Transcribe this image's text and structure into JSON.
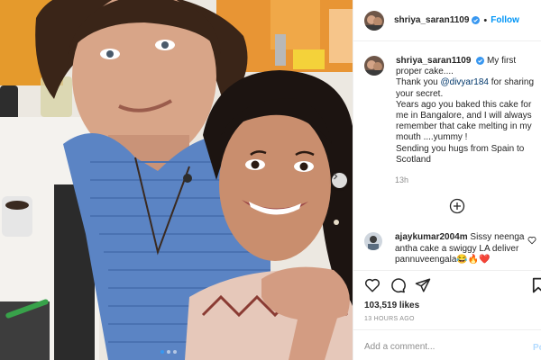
{
  "post": {
    "author": "shriya_saran1109",
    "follow_label": "Follow",
    "header_separator": "•",
    "caption_line_1": "My first proper cake....",
    "caption_thanks_prefix": "Thank you ",
    "caption_mention": "@divyar184",
    "caption_thanks_suffix": " for sharing your secret.",
    "caption_rest": "Years ago you baked this cake for me in Bangalore, and I will always remember that cake melting in my mouth ....yummy !\nSending you hugs from Spain to Scotland",
    "caption_time": "13h",
    "likes": "103,519 likes",
    "date": "13 HOURS AGO",
    "carousel": {
      "slide_count": 3,
      "active_index": 0
    }
  },
  "comments": [
    {
      "author": "ajaykumar2004m",
      "text": "Sissy neenga antha cake a swiggy LA deliver pannuveengala😂🔥❤️"
    }
  ],
  "composer": {
    "placeholder": "Add a comment...",
    "post_label": "Po"
  },
  "icons": {
    "verified": "verified-badge-icon",
    "next": "chevron-right-icon",
    "load_more": "plus-circle-icon",
    "like": "heart-icon",
    "comment": "comment-icon",
    "share": "paper-plane-icon",
    "save": "bookmark-icon"
  },
  "colors": {
    "link": "#0095f6",
    "mention": "#00376b",
    "muted": "#8e8e8e",
    "verified": "#3897f0"
  }
}
